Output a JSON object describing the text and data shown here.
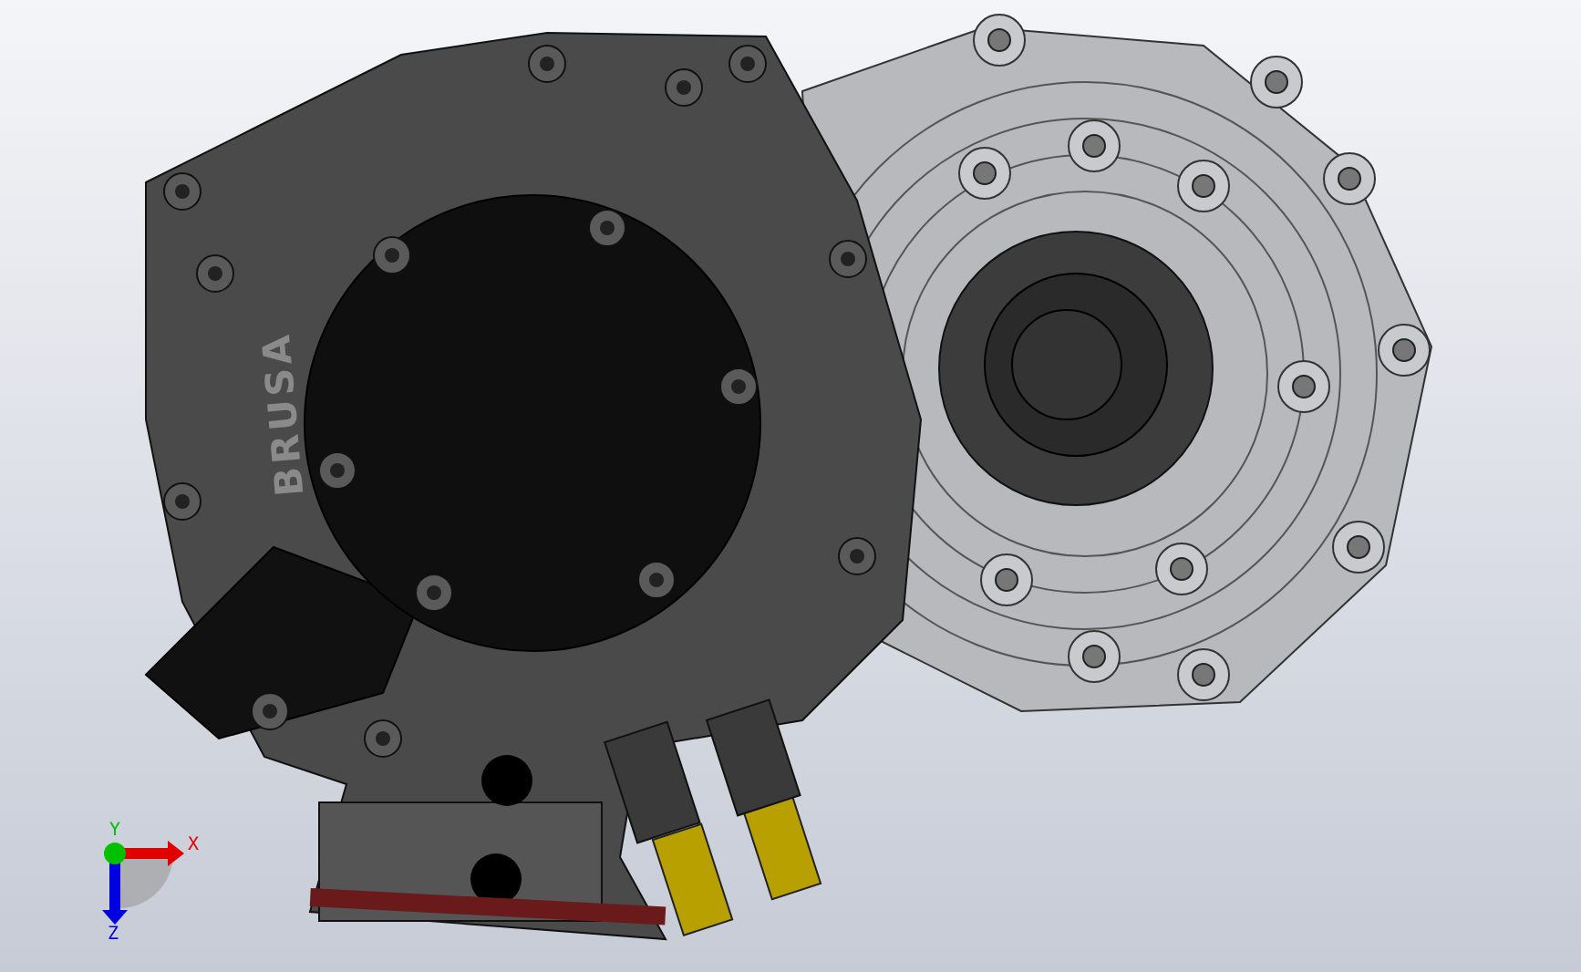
{
  "model": {
    "emboss": "BRUSA"
  },
  "triad": {
    "axes": [
      {
        "label": "X",
        "color": "#e00000"
      },
      {
        "label": "Y",
        "color": "#00c000"
      },
      {
        "label": "Z",
        "color": "#0000e0"
      }
    ]
  }
}
